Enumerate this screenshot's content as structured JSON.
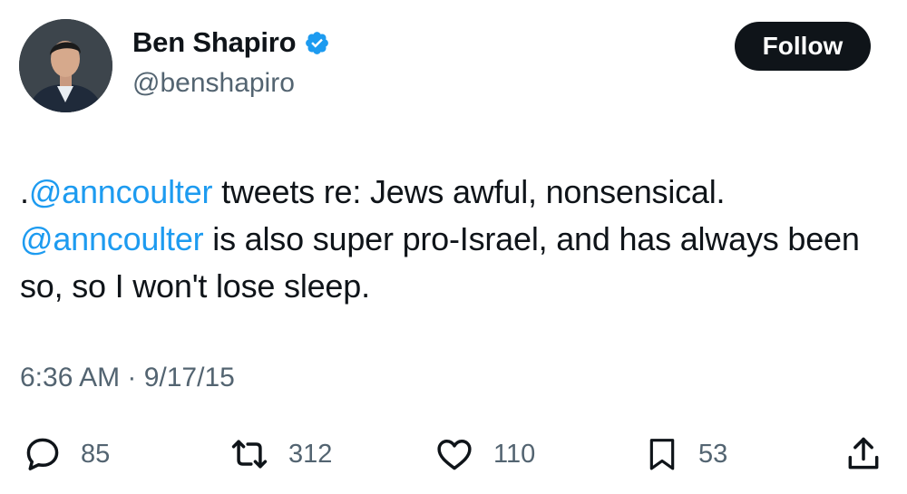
{
  "tweet": {
    "author": {
      "display_name": "Ben Shapiro",
      "handle": "@benshapiro",
      "verified": true,
      "verified_icon": "verified-badge-icon"
    },
    "follow_label": "Follow",
    "text": {
      "prefix": ".",
      "mention_1": "@anncoulter",
      "part_1": " tweets re: Jews awful, nonsensical. ",
      "mention_2": "@anncoulter",
      "part_2": " is also super pro-Israel, and has always been so, so I won't lose sleep."
    },
    "timestamp": "6:36 AM · 9/17/15",
    "actions": {
      "reply": {
        "icon": "reply-icon",
        "count": "85"
      },
      "repost": {
        "icon": "repost-icon",
        "count": "312"
      },
      "like": {
        "icon": "heart-icon",
        "count": "110"
      },
      "bookmark": {
        "icon": "bookmark-icon",
        "count": "53"
      },
      "share": {
        "icon": "share-icon"
      }
    }
  },
  "colors": {
    "text": "#0f1419",
    "secondary": "#536471",
    "link": "#1d9bf0",
    "verified": "#1d9bf0",
    "button_bg": "#0f1419",
    "button_text": "#ffffff",
    "background": "#ffffff"
  }
}
